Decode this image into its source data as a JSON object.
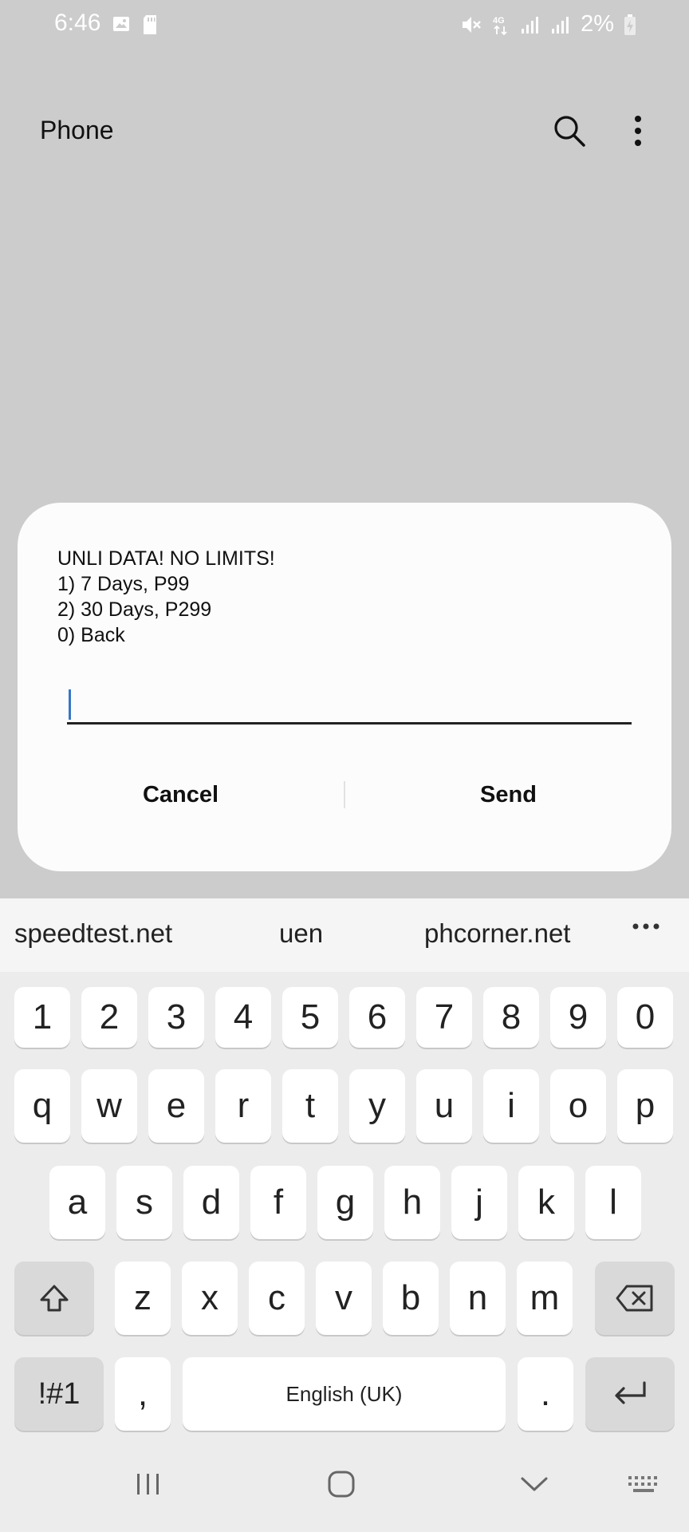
{
  "status_bar": {
    "time": "6:46",
    "battery": "2%",
    "icons": [
      "image-icon",
      "sd-card-icon",
      "mute-icon",
      "4g-icon",
      "signal-icon",
      "signal-icon",
      "battery-charging-icon"
    ]
  },
  "app_bar": {
    "title": "Phone",
    "icons": [
      "search-icon",
      "more-vert-icon"
    ]
  },
  "dialog": {
    "message": "UNLI DATA! NO LIMITS!\n1) 7 Days, P99\n2) 30 Days, P299\n0) Back",
    "input_value": "",
    "cancel_label": "Cancel",
    "send_label": "Send"
  },
  "keyboard": {
    "suggestions": [
      "speedtest.net",
      "uen",
      "phcorner.net"
    ],
    "row_numbers": [
      "1",
      "2",
      "3",
      "4",
      "5",
      "6",
      "7",
      "8",
      "9",
      "0"
    ],
    "row1": [
      "q",
      "w",
      "e",
      "r",
      "t",
      "y",
      "u",
      "i",
      "o",
      "p"
    ],
    "row2": [
      "a",
      "s",
      "d",
      "f",
      "g",
      "h",
      "j",
      "k",
      "l"
    ],
    "row3": [
      "z",
      "x",
      "c",
      "v",
      "b",
      "n",
      "m"
    ],
    "symbols_label": "!#1",
    "comma_label": ",",
    "space_label": "English (UK)",
    "period_label": ".",
    "colors": {
      "background": "#ececec",
      "key": "#ffffff",
      "function_key": "#d9d9d9"
    }
  },
  "nav_bar": {
    "icons": [
      "recents-icon",
      "home-icon",
      "back-icon",
      "keyboard-icon"
    ]
  },
  "colors": {
    "backdrop": "#cccccc",
    "dialog": "#fcfcfc",
    "caret": "#3677c6"
  }
}
